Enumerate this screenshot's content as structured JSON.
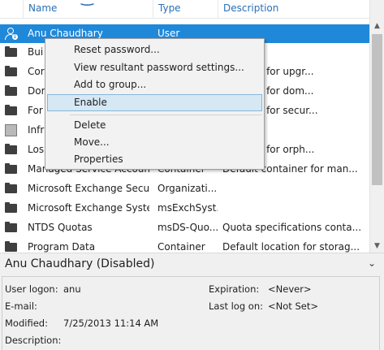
{
  "columns": {
    "name": "Name",
    "type": "Type",
    "description": "Description"
  },
  "rows": [
    {
      "icon": "user-disabled-icon",
      "name": "Anu Chaudhary",
      "type": "User",
      "description": "",
      "selected": true
    },
    {
      "icon": "folder-icon",
      "name": "Bui",
      "type": "",
      "description": ""
    },
    {
      "icon": "folder-icon",
      "name": "Cor",
      "type": "",
      "description": "ontainer for upgr..."
    },
    {
      "icon": "folder-icon",
      "name": "Dor",
      "type": "",
      "description": "ontainer for dom..."
    },
    {
      "icon": "folder-icon",
      "name": "For",
      "type": "",
      "description": "ontainer for secur..."
    },
    {
      "icon": "box-icon",
      "name": "Infr",
      "type": "",
      "description": ""
    },
    {
      "icon": "folder-icon",
      "name": "Los",
      "type": "",
      "description": "ontainer for orph..."
    },
    {
      "icon": "folder-icon",
      "name": "Managed Service Accounts",
      "type": "Container",
      "description": "Default container for man..."
    },
    {
      "icon": "folder-icon",
      "name": "Microsoft Exchange Securi...",
      "type": "Organizati...",
      "description": ""
    },
    {
      "icon": "folder-icon",
      "name": "Microsoft Exchange Syste...",
      "type": "msExchSyst...",
      "description": ""
    },
    {
      "icon": "folder-icon",
      "name": "NTDS Quotas",
      "type": "msDS-Quo...",
      "description": "Quota specifications conta..."
    },
    {
      "icon": "folder-icon",
      "name": "Program Data",
      "type": "Container",
      "description": "Default location for storag..."
    }
  ],
  "context_menu": {
    "items": [
      {
        "label": "Reset password..."
      },
      {
        "label": "View resultant password settings..."
      },
      {
        "label": "Add to group..."
      },
      {
        "label": "Enable",
        "highlighted": true
      },
      {
        "label": "Delete"
      },
      {
        "label": "Move..."
      },
      {
        "label": "Properties"
      }
    ]
  },
  "details": {
    "title": "Anu Chaudhary (Disabled)",
    "user_logon_label": "User logon:",
    "user_logon_value": "anu",
    "email_label": "E-mail:",
    "email_value": "",
    "modified_label": "Modified:",
    "modified_value": "7/25/2013 11:14 AM",
    "description_label": "Description:",
    "description_value": "",
    "expiration_label": "Expiration:",
    "expiration_value": "<Never>",
    "last_logon_label": "Last log on:",
    "last_logon_value": "<Not Set>"
  },
  "colors": {
    "selection": "#1f88d9",
    "header_text": "#2a6fb6",
    "menu_highlight": "#d6e8f4"
  }
}
